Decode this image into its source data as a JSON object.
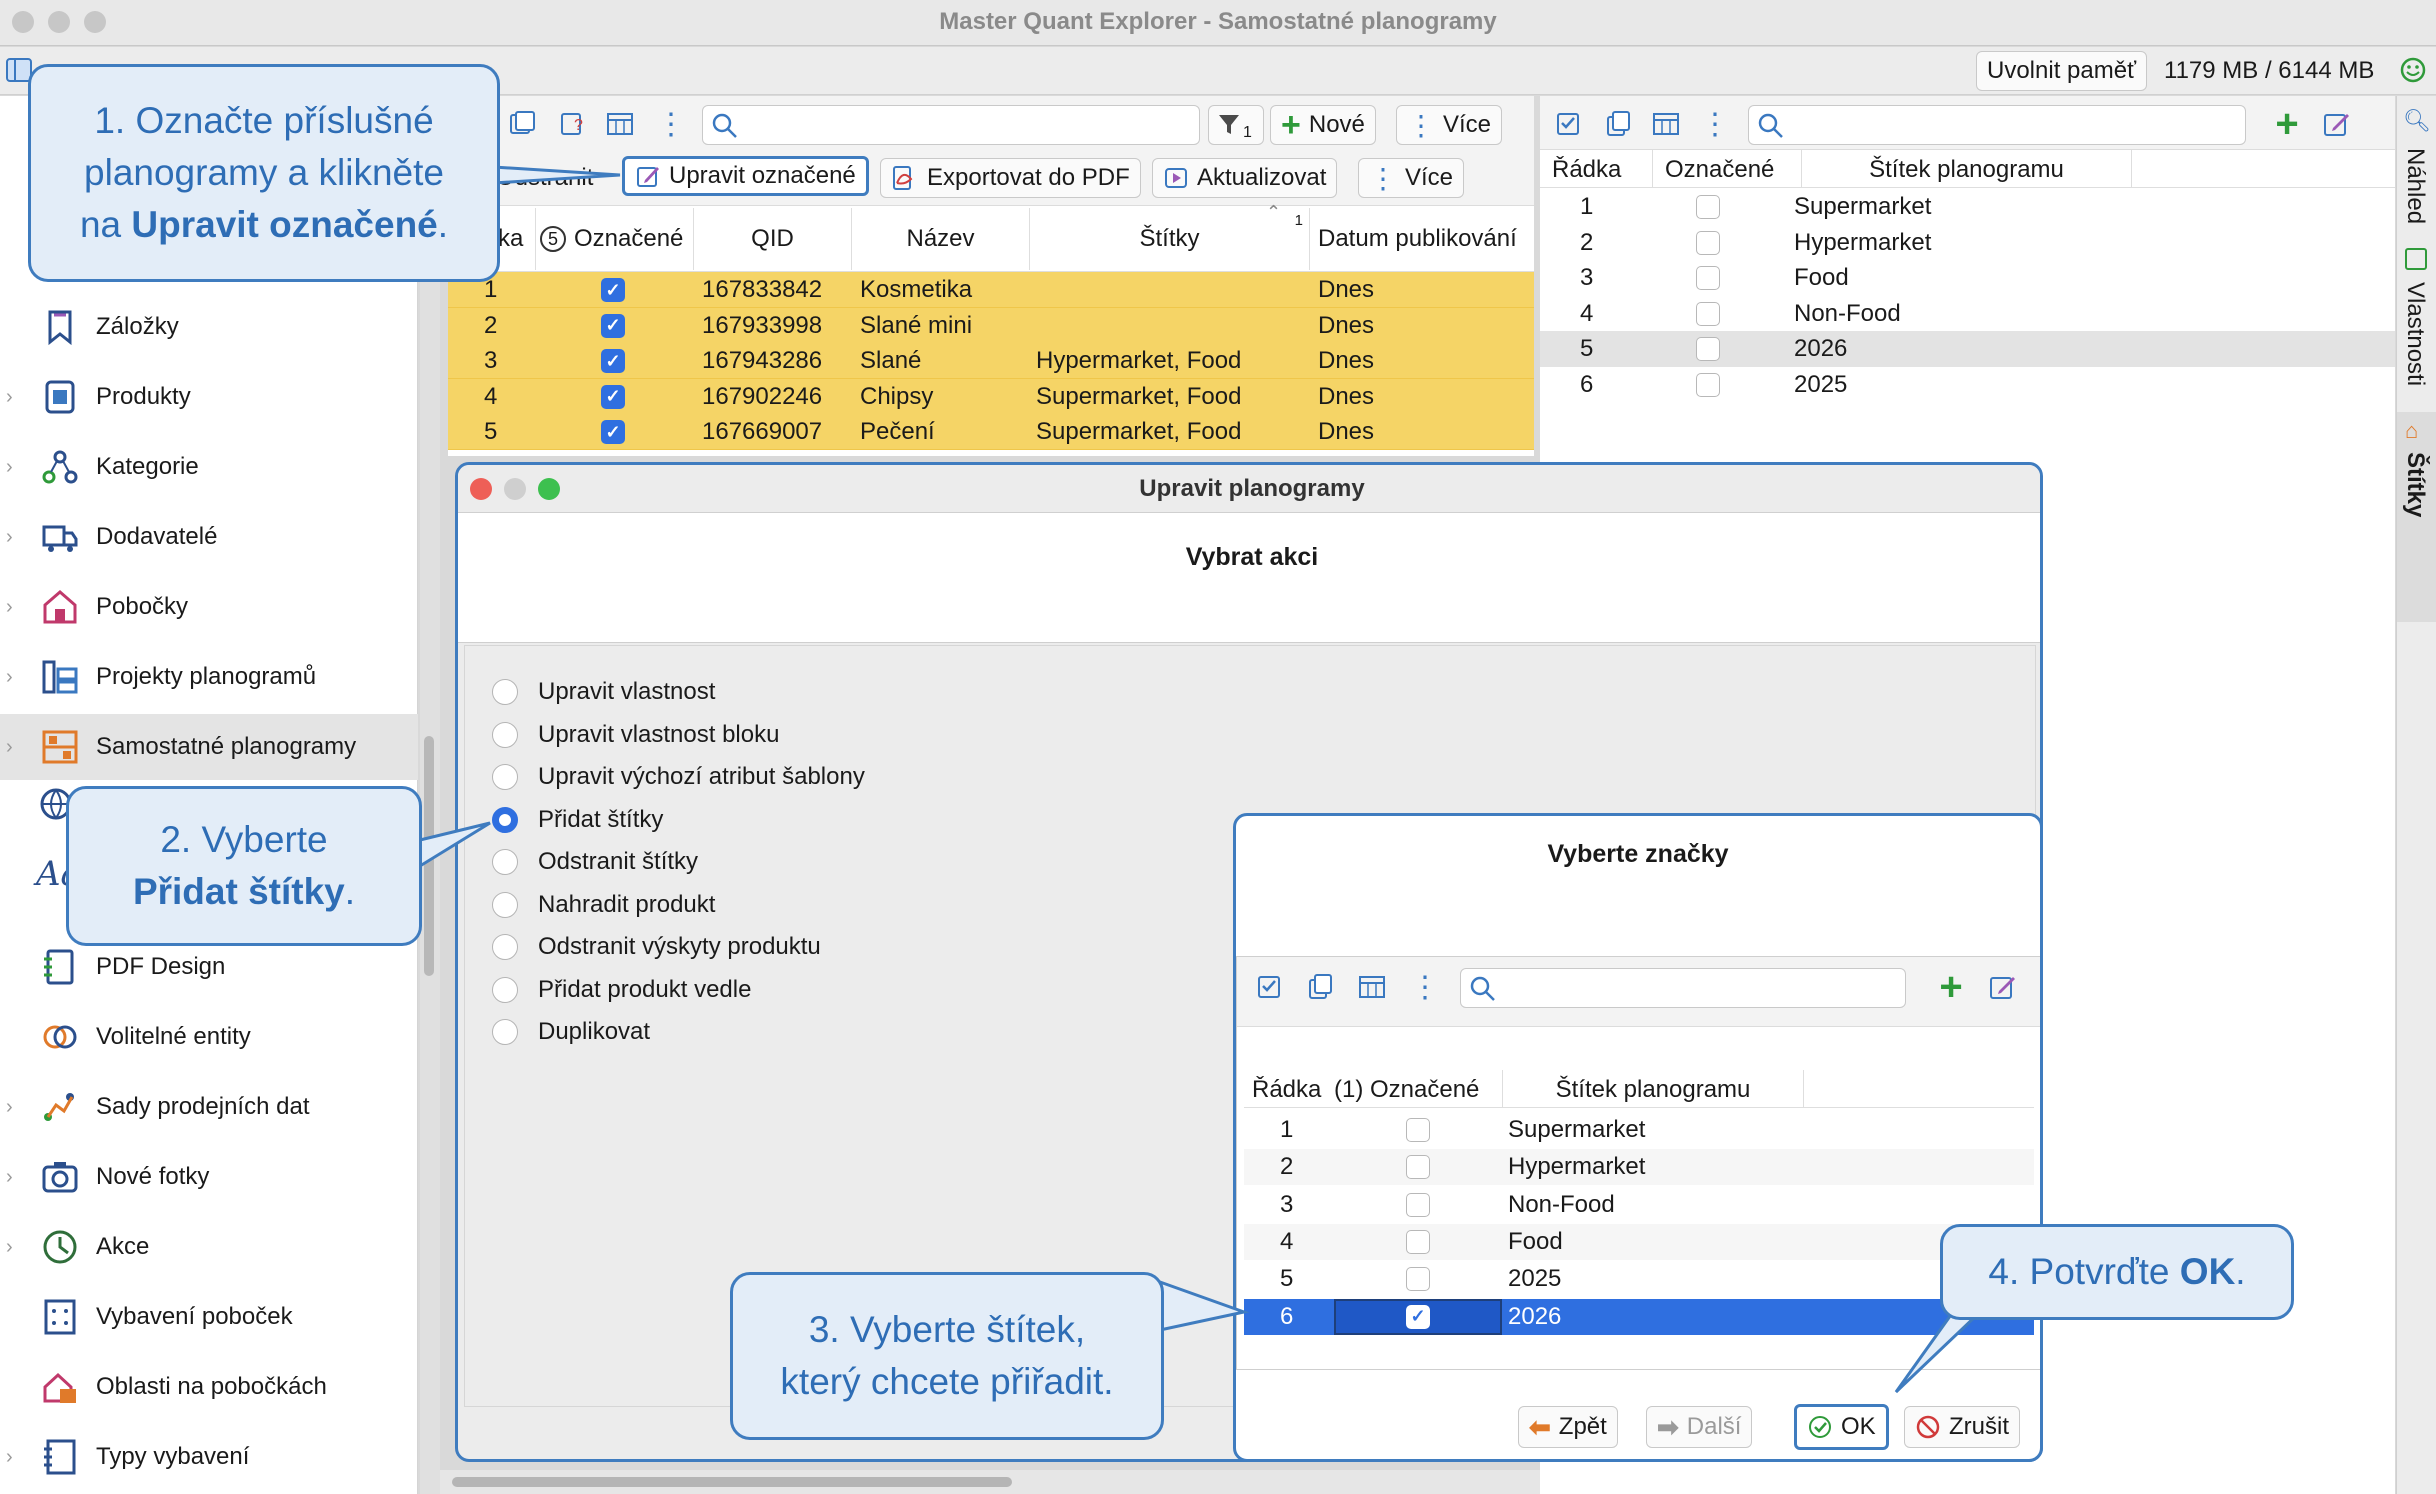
{
  "window": {
    "title": "Master Quant Explorer - Samostatné planogramy"
  },
  "memory": {
    "button": "Uvolnit paměť",
    "usage": "1179 MB / 6144 MB"
  },
  "mid_toolbar": {
    "new_label": "Nové",
    "more_label": "Více",
    "filter_count": "1",
    "remove_label": "Odstranit",
    "edit_selected_label": "Upravit označené",
    "export_pdf_label": "Exportovat do PDF",
    "refresh_label": "Aktualizovat",
    "more2_label": "Více"
  },
  "sidebar": {
    "items": [
      {
        "label": "Záložky",
        "icon": "bookmark-icon"
      },
      {
        "label": "Produkty",
        "icon": "product-icon"
      },
      {
        "label": "Kategorie",
        "icon": "category-icon"
      },
      {
        "label": "Dodavatelé",
        "icon": "supplier-icon"
      },
      {
        "label": "Pobočky",
        "icon": "store-icon"
      },
      {
        "label": "Projekty planogramů",
        "icon": "planogram-projects-icon"
      },
      {
        "label": "Samostatné planogramy",
        "icon": "planogram-icon"
      },
      {
        "label": "PDF Design",
        "icon": "pdf-design-icon"
      },
      {
        "label": "Volitelné entity",
        "icon": "optional-entities-icon"
      },
      {
        "label": "Sady prodejních dat",
        "icon": "sales-data-icon"
      },
      {
        "label": "Nové fotky",
        "icon": "camera-icon"
      },
      {
        "label": "Akce",
        "icon": "clock-icon"
      },
      {
        "label": "Vybavení poboček",
        "icon": "equipment-icon"
      },
      {
        "label": "Oblasti na pobočkách",
        "icon": "areas-icon"
      },
      {
        "label": "Typy vybavení",
        "icon": "equipment-types-icon"
      }
    ]
  },
  "planogram_table": {
    "headers": {
      "row": "ka",
      "checked": "Označené",
      "checked_count": "5",
      "qid": "QID",
      "name": "Název",
      "tags": "Štítky",
      "sort_index": "1",
      "published": "Datum publikování"
    },
    "rows": [
      {
        "n": "1",
        "qid": "167833842",
        "name": "Kosmetika",
        "tags": "",
        "published": "Dnes"
      },
      {
        "n": "2",
        "qid": "167933998",
        "name": "Slané mini",
        "tags": "",
        "published": "Dnes"
      },
      {
        "n": "3",
        "qid": "167943286",
        "name": "Slané",
        "tags": "Hypermarket, Food",
        "published": "Dnes"
      },
      {
        "n": "4",
        "qid": "167902246",
        "name": "Chipsy",
        "tags": "Supermarket, Food",
        "published": "Dnes"
      },
      {
        "n": "5",
        "qid": "167669007",
        "name": "Pečení",
        "tags": "Supermarket, Food",
        "published": "Dnes"
      }
    ]
  },
  "tag_table": {
    "headers": {
      "row": "Řádka",
      "checked": "Označené",
      "tag": "Štítek planogramu"
    },
    "rows": [
      {
        "n": "1",
        "tag": "Supermarket"
      },
      {
        "n": "2",
        "tag": "Hypermarket"
      },
      {
        "n": "3",
        "tag": "Food"
      },
      {
        "n": "4",
        "tag": "Non-Food"
      },
      {
        "n": "5",
        "tag": "2026"
      },
      {
        "n": "6",
        "tag": "2025"
      }
    ]
  },
  "vertical_tabs": [
    "Náhled",
    "Vlastnosti",
    "Štítky"
  ],
  "dialog": {
    "title": "Upravit planogramy",
    "heading": "Vybrat akci",
    "options": [
      "Upravit vlastnost",
      "Upravit vlastnost bloku",
      "Upravit výchozí atribut šablony",
      "Přidat štítky",
      "Odstranit štítky",
      "Nahradit produkt",
      "Odstranit výskyty produktu",
      "Přidat produkt vedle",
      "Duplikovat"
    ],
    "selected_option": "Přidat štítky"
  },
  "tag_dialog": {
    "heading": "Vyberte značky",
    "headers": {
      "row": "Řádka",
      "checked": "(1) Označené",
      "tag": "Štítek planogramu"
    },
    "rows": [
      {
        "n": "1",
        "tag": "Supermarket",
        "checked": false
      },
      {
        "n": "2",
        "tag": "Hypermarket",
        "checked": false
      },
      {
        "n": "3",
        "tag": "Non-Food",
        "checked": false
      },
      {
        "n": "4",
        "tag": "Food",
        "checked": false
      },
      {
        "n": "5",
        "tag": "2025",
        "checked": false
      },
      {
        "n": "6",
        "tag": "2026",
        "checked": true
      }
    ],
    "back_label": "Zpět",
    "next_label": "Další",
    "ok_label": "OK",
    "cancel_label": "Zrušit"
  },
  "callouts": {
    "c1": {
      "l1": "1. Označte příslušné",
      "l2": "planogramy a klikněte",
      "l3": "na ",
      "l3b": "Upravit označené",
      "l3e": "."
    },
    "c2": {
      "l1": "2. Vyberte",
      "l2b": "Přidat štítky",
      "l2e": "."
    },
    "c3": {
      "l1": "3. Vyberte štítek,",
      "l2": "který chcete přiřadit."
    },
    "c4": {
      "l1": "4. Potvrďte ",
      "l1b": "OK",
      "l1e": "."
    }
  },
  "colors": {
    "accent": "#2f6fe0",
    "highlight_row": "#f5d466",
    "callout_border": "#3f7cbf",
    "callout_text": "#2e6db5"
  }
}
